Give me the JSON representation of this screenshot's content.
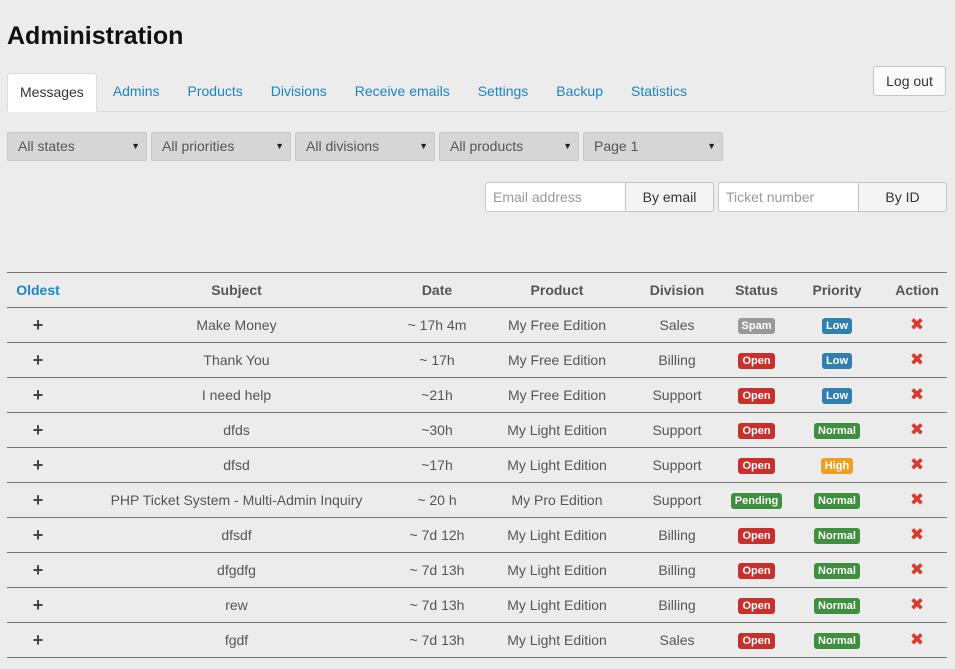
{
  "page_title": "Administration",
  "tabs": [
    {
      "label": "Messages",
      "active": true
    },
    {
      "label": "Admins"
    },
    {
      "label": "Products"
    },
    {
      "label": "Divisions"
    },
    {
      "label": "Receive emails"
    },
    {
      "label": "Settings"
    },
    {
      "label": "Backup"
    },
    {
      "label": "Statistics"
    }
  ],
  "logout_label": "Log out",
  "filters": {
    "state": "All states",
    "priority": "All priorities",
    "division": "All divisions",
    "product": "All products",
    "page": "Page 1"
  },
  "search": {
    "email_placeholder": "Email address",
    "email_button": "By email",
    "ticket_placeholder": "Ticket number",
    "ticket_button": "By ID"
  },
  "table": {
    "headers": {
      "sort": "Oldest",
      "subject": "Subject",
      "date": "Date",
      "product": "Product",
      "division": "Division",
      "status": "Status",
      "priority": "Priority",
      "action": "Action"
    },
    "rows": [
      {
        "subject": "Make Money",
        "date": "~ 17h 4m",
        "product": "My Free Edition",
        "division": "Sales",
        "status": "Spam",
        "priority": "Low"
      },
      {
        "subject": "Thank You",
        "date": "~ 17h",
        "product": "My Free Edition",
        "division": "Billing",
        "status": "Open",
        "priority": "Low"
      },
      {
        "subject": "I need help",
        "date": "~21h",
        "product": "My Free Edition",
        "division": "Support",
        "status": "Open",
        "priority": "Low"
      },
      {
        "subject": "dfds",
        "date": "~30h",
        "product": "My Light Edition",
        "division": "Support",
        "status": "Open",
        "priority": "Normal"
      },
      {
        "subject": "dfsd",
        "date": "~17h",
        "product": "My Light Edition",
        "division": "Support",
        "status": "Open",
        "priority": "High"
      },
      {
        "subject": "PHP Ticket System - Multi-Admin Inquiry",
        "date": "~ 20 h",
        "product": "My Pro Edition",
        "division": "Support",
        "status": "Pending",
        "priority": "Normal"
      },
      {
        "subject": "dfsdf",
        "date": "~ 7d 12h",
        "product": "My Light Edition",
        "division": "Billing",
        "status": "Open",
        "priority": "Normal"
      },
      {
        "subject": "dfgdfg",
        "date": "~ 7d 13h",
        "product": "My Light Edition",
        "division": "Billing",
        "status": "Open",
        "priority": "Normal"
      },
      {
        "subject": "rew",
        "date": "~ 7d 13h",
        "product": "My Light Edition",
        "division": "Billing",
        "status": "Open",
        "priority": "Normal"
      },
      {
        "subject": "fgdf",
        "date": "~ 7d 13h",
        "product": "My Light Edition",
        "division": "Sales",
        "status": "Open",
        "priority": "Normal"
      }
    ]
  },
  "icons": {
    "expand": "plus-icon",
    "delete": "close-x-icon",
    "dropdown": "caret-down-icon"
  },
  "colors": {
    "link": "#1a84c6",
    "status": {
      "Spam": "#999999",
      "Open": "#c9302c",
      "Pending": "#3e8f3e"
    },
    "priority": {
      "Low": "#2f7fb0",
      "Normal": "#3e8f3e",
      "High": "#f0a020"
    },
    "delete": "#d83a2e"
  }
}
